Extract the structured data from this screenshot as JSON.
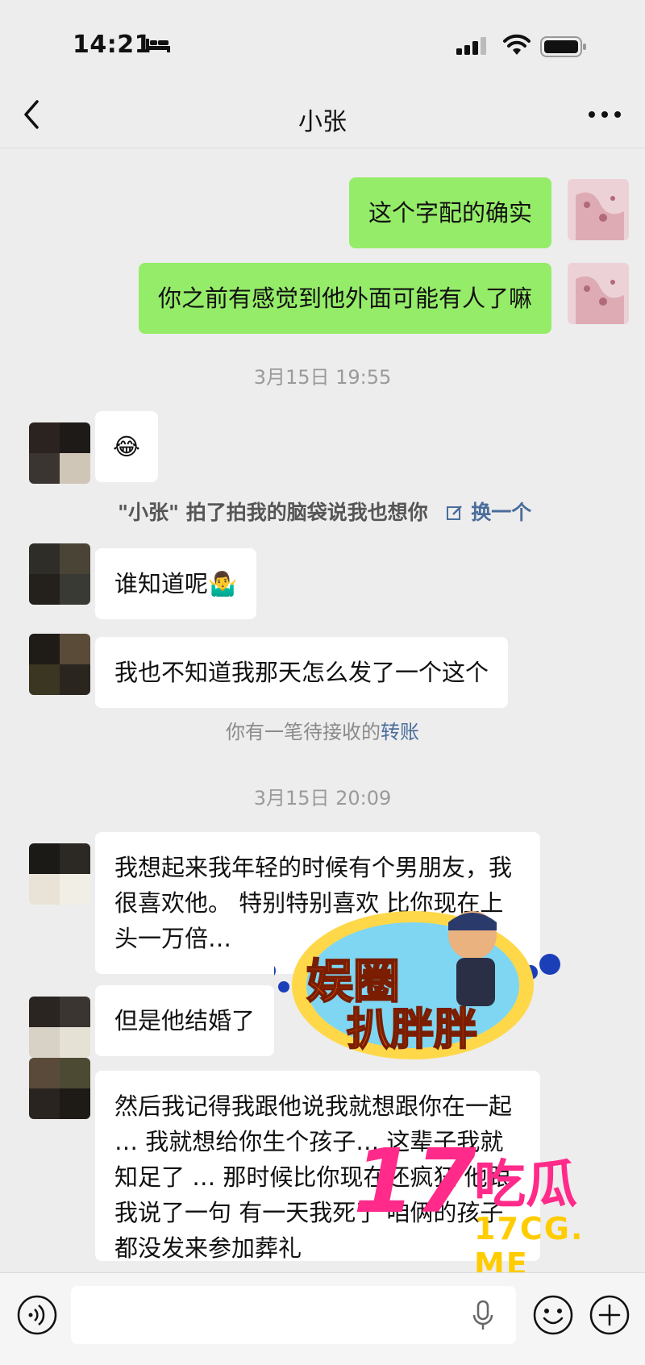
{
  "status_bar": {
    "time": "14:21"
  },
  "header": {
    "title": "小张"
  },
  "messages": [
    {
      "side": "right",
      "text": "这个字配的确实"
    },
    {
      "side": "right",
      "text": "你之前有感觉到他外面可能有人了嘛"
    },
    {
      "side": "left",
      "text": "😂"
    },
    {
      "side": "left",
      "text": "谁知道呢🤷‍♂️"
    },
    {
      "side": "left",
      "text": "我也不知道我那天怎么发了一个这个"
    },
    {
      "side": "left",
      "text": "我想起来我年轻的时候有个男朋友，我很喜欢他。 特别特别喜欢 比你现在上头一万倍…"
    },
    {
      "side": "left",
      "text": "但是他结婚了"
    },
    {
      "side": "left",
      "text": "然后我记得我跟他说我就想跟你在一起 … 我就想给你生个孩子… 这辈子我就知足了 … 那时候比你现在还疯狂 他跟我说了一句 有一天我死了 咱俩的孩子都没发来参加葬礼"
    }
  ],
  "timestamps": [
    "3月15日 19:55",
    "3月15日 20:09"
  ],
  "pat": {
    "text": "\"小张\" 拍了拍我的脑袋说我也想你",
    "action": "换一个"
  },
  "transfer": {
    "text": "你有一笔待接收的",
    "link": "转账"
  },
  "watermarks": {
    "show_line1": "娱圈",
    "show_line2": "扒胖胖",
    "site_number": "17",
    "site_name": "吃瓜",
    "site_url": "17CG. ME"
  },
  "colors": {
    "background": "#ededed",
    "mine_bubble": "#95ec69",
    "other_bubble": "#ffffff",
    "link": "#4a6d9c"
  }
}
